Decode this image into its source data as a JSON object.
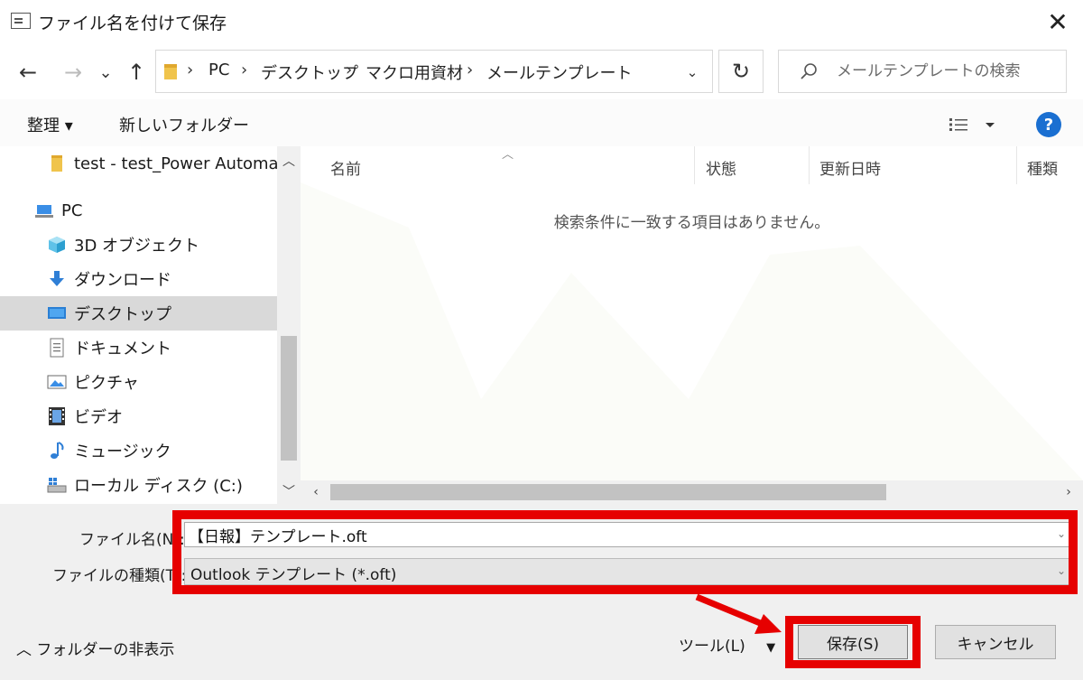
{
  "window": {
    "title": "ファイル名を付けて保存",
    "close_glyph": "✕"
  },
  "nav": {
    "back": "←",
    "forward": "→",
    "recent": "⌄",
    "up": "↑",
    "refresh": "↻",
    "dropdown": "⌄"
  },
  "breadcrumb": [
    "PC",
    "デスクトップ",
    "マクロ用資材",
    "メールテンプレート"
  ],
  "breadcrumb_sep": "›",
  "search": {
    "placeholder": "メールテンプレートの検索"
  },
  "toolbar": {
    "organize": "整理 ▾",
    "new_folder": "新しいフォルダー",
    "help": "?"
  },
  "sidebar": {
    "items": [
      {
        "label": "test - test_Power Automate",
        "icon": "folder-icon"
      },
      {
        "label": "PC",
        "icon": "pc-icon"
      },
      {
        "label": "3D オブジェクト",
        "icon": "cube-icon"
      },
      {
        "label": "ダウンロード",
        "icon": "download-icon"
      },
      {
        "label": "デスクトップ",
        "icon": "desktop-icon"
      },
      {
        "label": "ドキュメント",
        "icon": "document-icon"
      },
      {
        "label": "ピクチャ",
        "icon": "picture-icon"
      },
      {
        "label": "ビデオ",
        "icon": "video-icon"
      },
      {
        "label": "ミュージック",
        "icon": "music-icon"
      },
      {
        "label": "ローカル ディスク (C:)",
        "icon": "disk-icon"
      }
    ],
    "scroll_up": "︿",
    "scroll_down": "﹀"
  },
  "columns": [
    "名前",
    "状態",
    "更新日時",
    "種類"
  ],
  "sort_glyph": "︿",
  "empty_message": "検索条件に一致する項目はありません。",
  "hscroll": {
    "left": "‹",
    "right": "›"
  },
  "form": {
    "filename_label": "ファイル名(N):",
    "filename_value": "【日報】テンプレート.oft",
    "filetype_label": "ファイルの種類(T):",
    "filetype_value": "Outlook テンプレート (*.oft)",
    "caret": "⌄"
  },
  "footer": {
    "hide_folders": "︿  フォルダーの非表示",
    "tools": "ツール(L)",
    "tools_caret": "▼",
    "save": "保存(S)",
    "cancel": "キャンセル"
  },
  "colors": {
    "highlight": "#e60000",
    "selected": "#d9d9d9",
    "help": "#1a6fd1"
  }
}
